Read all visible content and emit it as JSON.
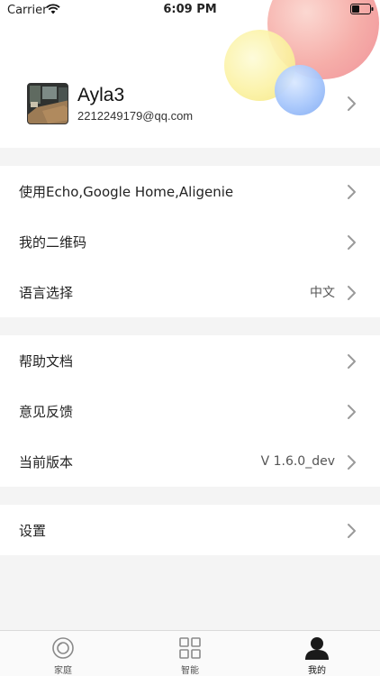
{
  "status_bar": {
    "carrier": "Carrier",
    "time": "6:09 PM"
  },
  "profile": {
    "name": "Ayla3",
    "email": "2212249179@qq.com"
  },
  "menu_groups": [
    {
      "items": [
        {
          "label": "使用Echo,Google Home,Aligenie",
          "value": ""
        },
        {
          "label": "我的二维码",
          "value": ""
        },
        {
          "label": "语言选择",
          "value": "中文"
        }
      ]
    },
    {
      "items": [
        {
          "label": "帮助文档",
          "value": ""
        },
        {
          "label": "意见反馈",
          "value": ""
        },
        {
          "label": "当前版本",
          "value": "V 1.6.0_dev"
        }
      ]
    },
    {
      "items": [
        {
          "label": "设置",
          "value": ""
        }
      ]
    }
  ],
  "tabbar": {
    "tabs": [
      {
        "label": "家庭",
        "icon": "home-ring-icon",
        "active": false
      },
      {
        "label": "智能",
        "icon": "grid-icon",
        "active": false
      },
      {
        "label": "我的",
        "icon": "person-icon",
        "active": true
      }
    ]
  },
  "colors": {
    "background": "#f4f4f4",
    "surface": "#ffffff",
    "chevron": "#9a9a9a",
    "active_tab": "#111111"
  }
}
